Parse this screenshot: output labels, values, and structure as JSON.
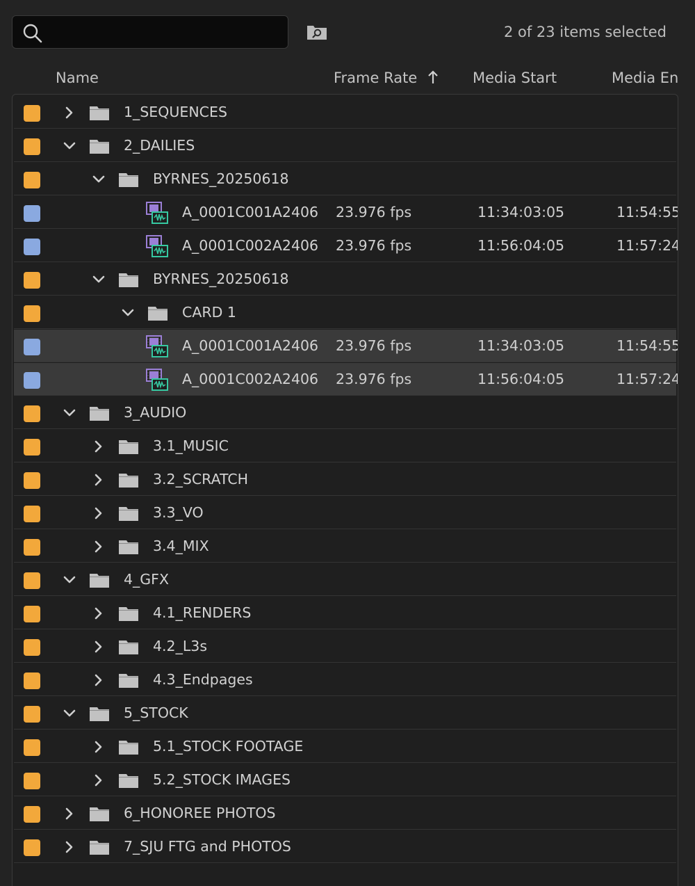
{
  "search": {
    "placeholder": "",
    "value": ""
  },
  "status": {
    "selection_text": "2 of 23 items selected"
  },
  "columns": {
    "name": "Name",
    "frame_rate": "Frame Rate",
    "media_start": "Media Start",
    "media_end": "Media En"
  },
  "colors": {
    "folder_label": "#f2a83b",
    "clip_label": "#8aa9e0",
    "clip_icon_purple": "#9b7fd6",
    "clip_icon_green": "#36c9a2"
  },
  "rows": [
    {
      "type": "folder",
      "depth": 0,
      "expanded": false,
      "name": "1_SEQUENCES"
    },
    {
      "type": "folder",
      "depth": 0,
      "expanded": true,
      "name": "2_DAILIES"
    },
    {
      "type": "folder",
      "depth": 1,
      "expanded": true,
      "name": "BYRNES_20250618"
    },
    {
      "type": "clip",
      "depth": 2,
      "name": "A_0001C001A2406",
      "frame_rate": "23.976 fps",
      "media_start": "11:34:03:05",
      "media_end": "11:54:55",
      "selected": false
    },
    {
      "type": "clip",
      "depth": 2,
      "name": "A_0001C002A2406",
      "frame_rate": "23.976 fps",
      "media_start": "11:56:04:05",
      "media_end": "11:57:24",
      "selected": false
    },
    {
      "type": "folder",
      "depth": 1,
      "expanded": true,
      "name": "BYRNES_20250618"
    },
    {
      "type": "folder",
      "depth": 2,
      "expanded": true,
      "name": "CARD 1"
    },
    {
      "type": "clip",
      "depth": 2,
      "name": "A_0001C001A2406",
      "frame_rate": "23.976 fps",
      "media_start": "11:34:03:05",
      "media_end": "11:54:55",
      "selected": true
    },
    {
      "type": "clip",
      "depth": 2,
      "name": "A_0001C002A2406",
      "frame_rate": "23.976 fps",
      "media_start": "11:56:04:05",
      "media_end": "11:57:24",
      "selected": true
    },
    {
      "type": "folder",
      "depth": 0,
      "expanded": true,
      "name": "3_AUDIO"
    },
    {
      "type": "folder",
      "depth": 1,
      "expanded": false,
      "name": "3.1_MUSIC"
    },
    {
      "type": "folder",
      "depth": 1,
      "expanded": false,
      "name": "3.2_SCRATCH"
    },
    {
      "type": "folder",
      "depth": 1,
      "expanded": false,
      "name": "3.3_VO"
    },
    {
      "type": "folder",
      "depth": 1,
      "expanded": false,
      "name": "3.4_MIX"
    },
    {
      "type": "folder",
      "depth": 0,
      "expanded": true,
      "name": "4_GFX"
    },
    {
      "type": "folder",
      "depth": 1,
      "expanded": false,
      "name": "4.1_RENDERS"
    },
    {
      "type": "folder",
      "depth": 1,
      "expanded": false,
      "name": "4.2_L3s"
    },
    {
      "type": "folder",
      "depth": 1,
      "expanded": false,
      "name": "4.3_Endpages"
    },
    {
      "type": "folder",
      "depth": 0,
      "expanded": true,
      "name": "5_STOCK"
    },
    {
      "type": "folder",
      "depth": 1,
      "expanded": false,
      "name": "5.1_STOCK FOOTAGE"
    },
    {
      "type": "folder",
      "depth": 1,
      "expanded": false,
      "name": "5.2_STOCK IMAGES"
    },
    {
      "type": "folder",
      "depth": 0,
      "expanded": false,
      "name": "6_HONOREE PHOTOS"
    },
    {
      "type": "folder",
      "depth": 0,
      "expanded": false,
      "name": "7_SJU  FTG and PHOTOS"
    }
  ]
}
